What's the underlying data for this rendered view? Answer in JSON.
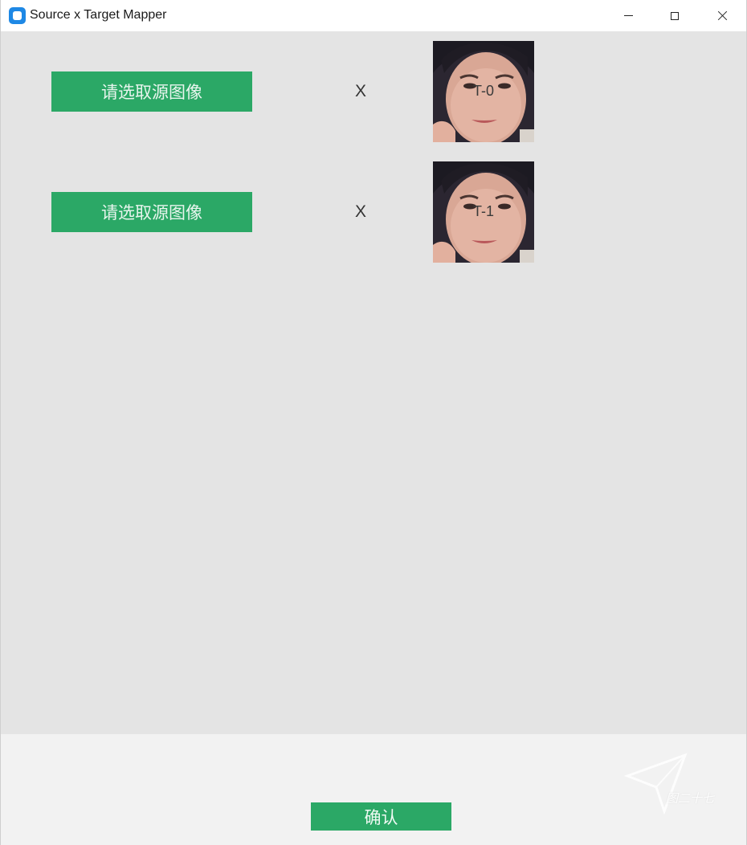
{
  "window": {
    "title": "Source x Target Mapper",
    "controls": {
      "minimize": "minimize",
      "maximize": "maximize",
      "close": "close"
    }
  },
  "rows": [
    {
      "source_button_label": "请选取源图像",
      "separator": "X",
      "target_label": "T-0"
    },
    {
      "source_button_label": "请选取源图像",
      "separator": "X",
      "target_label": "T-1"
    }
  ],
  "footer": {
    "confirm_label": "确认",
    "watermark_text": "图二十七"
  },
  "colors": {
    "accent_green": "#2ba866",
    "content_bg": "#e4e4e4",
    "footer_bg": "#f2f2f2",
    "app_icon_blue": "#1e88e5"
  },
  "icons": [
    "app-icon",
    "minimize-icon",
    "maximize-icon",
    "close-icon",
    "paper-plane-watermark-icon"
  ]
}
